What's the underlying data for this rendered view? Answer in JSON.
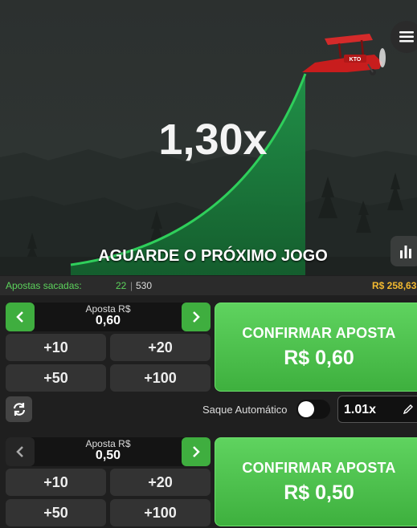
{
  "game": {
    "multiplier": "1,30x",
    "status_message": "AGUARDE O PRÓXIMO JOGO",
    "plane_label": "KTO",
    "colors": {
      "curve": "#2fcf5b",
      "plane": "#c81d1d"
    }
  },
  "bets_bar": {
    "label": "Apostas sacadas:",
    "cashed_count": "22",
    "total_count": "530",
    "total_amount": "R$ 258,63"
  },
  "panel1": {
    "caption": "Aposta R$",
    "amount": "0,60",
    "quick": [
      "+10",
      "+20",
      "+50",
      "+100"
    ],
    "confirm_title": "CONFIRMAR APOSTA",
    "confirm_amount": "R$ 0,60"
  },
  "auto": {
    "label": "Saque Automático",
    "toggle_on": false,
    "value": "1.01x"
  },
  "panel2": {
    "caption": "Aposta R$",
    "amount": "0,50",
    "quick": [
      "+10",
      "+20",
      "+50",
      "+100"
    ],
    "confirm_title": "CONFIRMAR APOSTA",
    "confirm_amount": "R$ 0,50"
  }
}
